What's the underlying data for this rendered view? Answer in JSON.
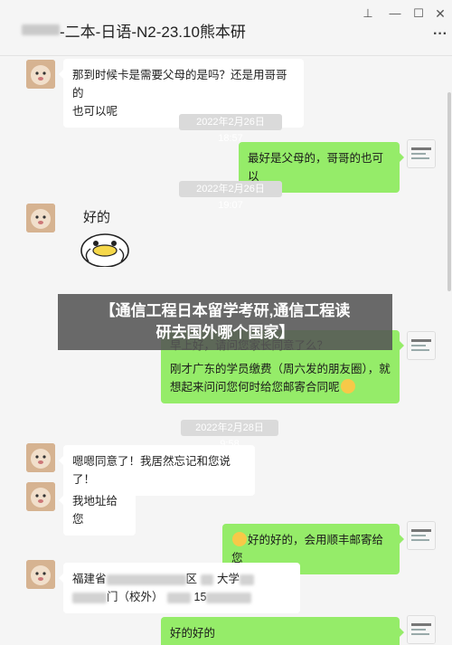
{
  "window": {
    "title": "-二本-日语-N2-23.10熊本研",
    "buttons": {
      "pin": "⊥",
      "minimize": "—",
      "maximize": "☐",
      "close": "✕",
      "more": "···"
    }
  },
  "messages": [
    {
      "side": "left",
      "text_line1": "那到时候卡是需要父母的是吗？还是用哥哥的",
      "text_line2": "也可以呢"
    },
    {
      "timestamp": "2022年2月26日 18:57"
    },
    {
      "side": "right",
      "text": "最好是父母的，哥哥的也可以"
    },
    {
      "timestamp": "2022年2月26日 19:07"
    },
    {
      "side": "left",
      "sticker_text": "好的"
    },
    {
      "side": "right",
      "text_line1": "早上好，请问您家长同意了么？",
      "text_line2": "刚才广东的学员缴费（周六发的朋友圈），就",
      "text_line3": "想起来问问您何时给您邮寄合同呢"
    },
    {
      "timestamp": "2022年2月28日 9:58"
    },
    {
      "side": "left",
      "text": "嗯嗯同意了！我居然忘记和您说了！"
    },
    {
      "side": "left",
      "text": "我地址给您"
    },
    {
      "side": "right",
      "text": "好的好的，会用顺丰邮寄给您"
    },
    {
      "side": "left",
      "text_line1_a": "福建省",
      "text_line1_b": "区",
      "text_line1_c": "大学",
      "text_line2_a": "门（校外）",
      "text_line2_b": "15"
    },
    {
      "side": "right",
      "text": "好的好的"
    }
  ],
  "overlay": {
    "line1": "【通信工程日本留学考研,通信工程读",
    "line2": "研去国外哪个国家】"
  },
  "colors": {
    "green_bubble": "#95ec69",
    "white_bubble": "#ffffff",
    "background": "#f5f5f5"
  }
}
